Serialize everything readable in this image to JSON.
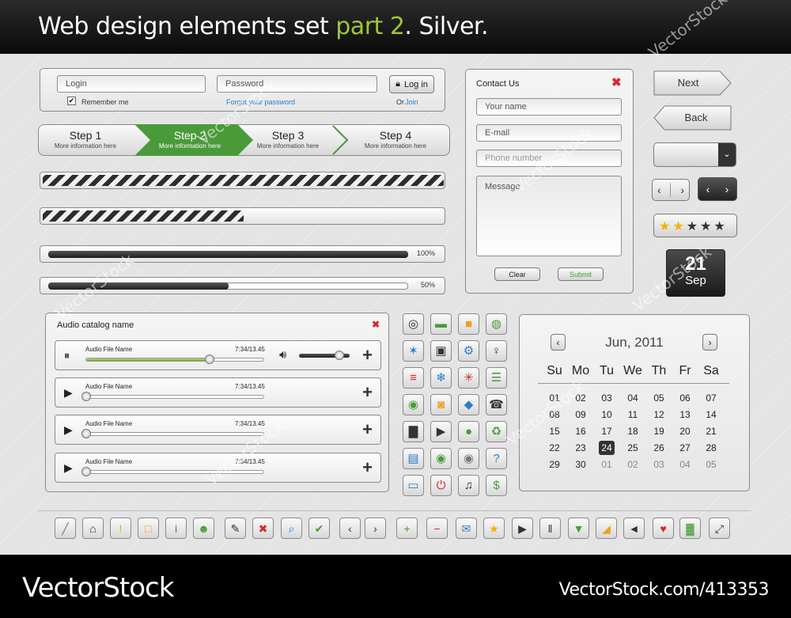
{
  "title": {
    "prefix": "Web design elements set ",
    "accent": "part 2",
    "suffix": ". Silver.",
    "accent_color": "#9fc63b"
  },
  "login": {
    "login_placeholder": "Login",
    "password_placeholder": "Password",
    "login_button": "Log in",
    "remember_me": "Remember me",
    "forgot": "Forgot your password",
    "or": "Or",
    "join": "Join"
  },
  "steps": [
    {
      "label": "Step 1",
      "sub": "More information here",
      "active": false
    },
    {
      "label": "Step 2",
      "sub": "More information here",
      "active": true
    },
    {
      "label": "Step 3",
      "sub": "More information here",
      "active": false
    },
    {
      "label": "Step 4",
      "sub": "More information here",
      "active": false
    }
  ],
  "progress": {
    "striped_full": 1.0,
    "striped_half": 0.5,
    "bar1_label": "100%",
    "bar1_value": 1.0,
    "bar2_label": "50%",
    "bar2_value": 0.5
  },
  "contact": {
    "title": "Contact Us",
    "name": "Your name",
    "email": "E-mail",
    "phone": "Phone number",
    "message": "Message",
    "clear": "Clear",
    "submit": "Submit"
  },
  "nav": {
    "next": "Next",
    "back": "Back"
  },
  "rating": {
    "value": 2,
    "max": 5
  },
  "date_badge": {
    "day": "21",
    "month": "Sep"
  },
  "audio": {
    "title": "Audio catalog name",
    "tracks": [
      {
        "name": "Audio File Name",
        "time": "7:34/13.45",
        "state": "playing",
        "progress": 0.69
      },
      {
        "name": "Audio File Name",
        "time": "7:34/13.45",
        "state": "stopped",
        "progress": 0
      },
      {
        "name": "Audio File Name",
        "time": "7:34/13.45",
        "state": "stopped",
        "progress": 0
      },
      {
        "name": "Audio File Name",
        "time": "7:34/13.45",
        "state": "stopped",
        "progress": 0
      }
    ],
    "volume": 0.8
  },
  "calendar": {
    "month_label": "Jun, 2011",
    "weekdays": [
      "Su",
      "Mo",
      "Tu",
      "We",
      "Th",
      "Fr",
      "Sa"
    ],
    "weeks": [
      [
        "01",
        "02",
        "03",
        "04",
        "05",
        "06",
        "07"
      ],
      [
        "08",
        "09",
        "10",
        "11",
        "12",
        "13",
        "14"
      ],
      [
        "15",
        "16",
        "17",
        "18",
        "19",
        "20",
        "21"
      ],
      [
        "22",
        "23",
        "24",
        "25",
        "26",
        "27",
        "28"
      ],
      [
        "29",
        "30",
        "01",
        "02",
        "03",
        "04",
        "05"
      ]
    ],
    "selected": "24"
  },
  "footer": {
    "brand": "VectorStock",
    "url": "VectorStock.com/413353"
  },
  "watermark": "VectorStock"
}
